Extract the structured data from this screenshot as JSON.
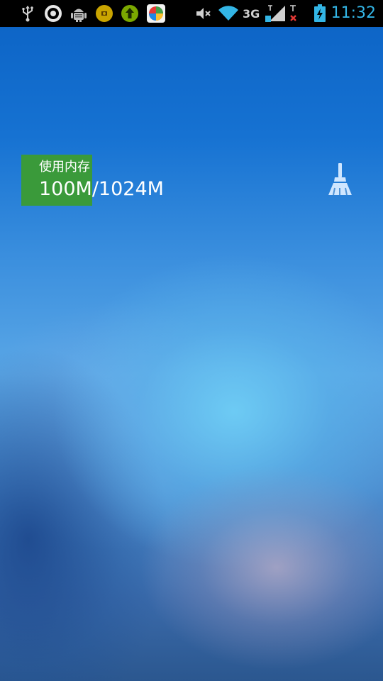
{
  "status_bar": {
    "left_icons": [
      "usb-icon",
      "sync-icon",
      "android-debug-icon",
      "game-app-icon",
      "upload-app-icon",
      "colorful-app-icon"
    ],
    "right_icons": [
      "mute-icon",
      "wifi-icon",
      "network-3g-icon",
      "signal-sim1-icon",
      "signal-sim2-none-icon",
      "battery-charging-icon"
    ],
    "network_label": "3G",
    "time": "11:32",
    "clock_color": "#33b5e5"
  },
  "memory": {
    "label": "使用内存",
    "value": "100M/1024M",
    "used_mb": 100,
    "total_mb": 1024,
    "accent_color": "#3a9a3a"
  },
  "clean_button": {
    "icon": "broom-icon",
    "color": "#cfe6ff"
  }
}
